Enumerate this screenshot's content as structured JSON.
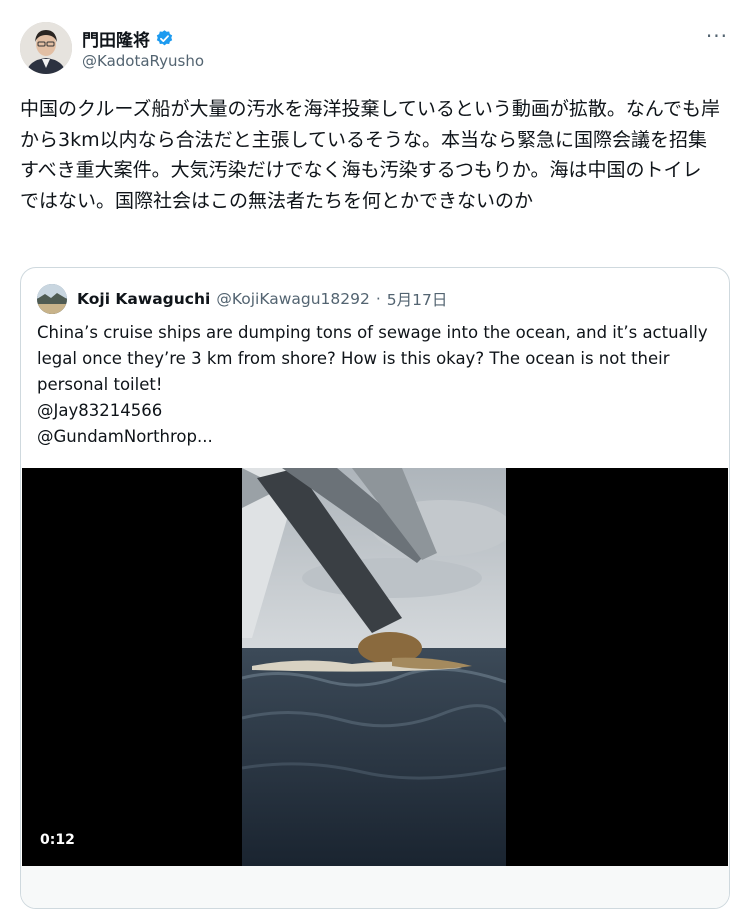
{
  "author": {
    "name": "門田隆将",
    "handle": "@KadotaRyusho",
    "verified": true,
    "verified_color": "#1d9bf0"
  },
  "more_icon": "···",
  "tweet": {
    "text": "中国のクルーズ船が大量の汚水を海洋投棄しているという動画が拡散。なんでも岸から3km以内なら合法だと主張しているそうな。本当なら緊急に国際会議を招集すべき重大案件。大気汚染だけでなく海も汚染するつもりか。海は中国のトイレではない。国際社会はこの無法者たちを何とかできないのか"
  },
  "quoted_tweet": {
    "name": "Koji Kawaguchi",
    "handle": "@KojiKawagu18292",
    "separator": "·",
    "date": "5月17日",
    "lines": [
      "China’s cruise ships are dumping tons of sewage into the ocean, and it’s actually",
      "legal once they’re 3 km from shore? How is this okay? The ocean is not their",
      "personal toilet!",
      "@Jay83214566",
      "@GundamNorthrop..."
    ],
    "video": {
      "duration": "0:12"
    }
  },
  "colors": {
    "text": "#0f1419",
    "secondary": "#536471",
    "border": "#cfd9de",
    "accent": "#1d9bf0"
  }
}
